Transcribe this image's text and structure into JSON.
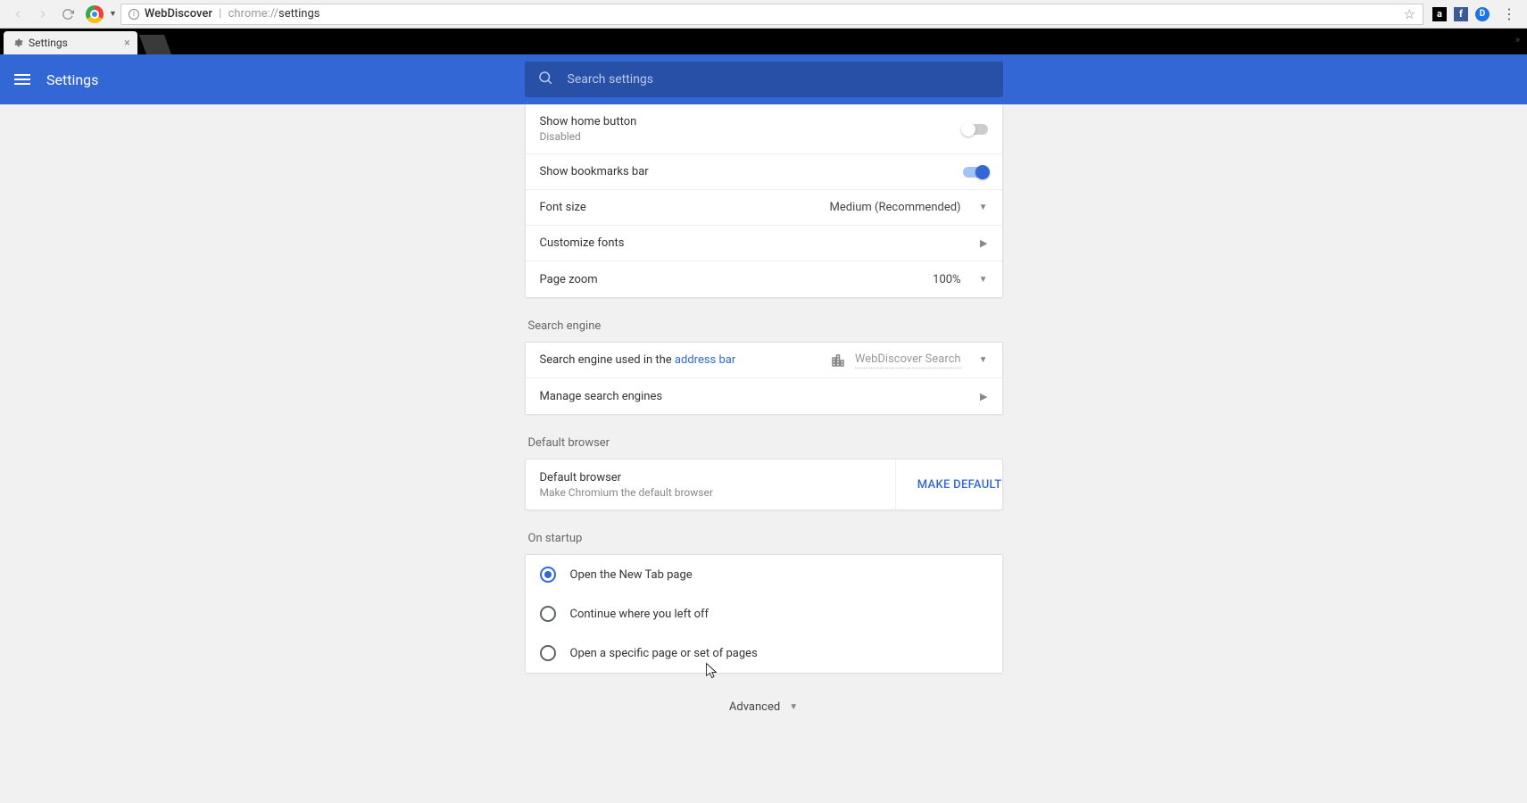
{
  "browser": {
    "address_prefix": "WebDiscover",
    "url_scheme": "chrome://",
    "url_path": "settings",
    "tab_title": "Settings"
  },
  "header": {
    "title": "Settings",
    "search_placeholder": "Search settings"
  },
  "appearance": {
    "show_home_label": "Show home button",
    "show_home_sub": "Disabled",
    "show_bookmarks_label": "Show bookmarks bar",
    "font_size_label": "Font size",
    "font_size_value": "Medium (Recommended)",
    "customize_fonts_label": "Customize fonts",
    "page_zoom_label": "Page zoom",
    "page_zoom_value": "100%"
  },
  "search_engine": {
    "section_title": "Search engine",
    "used_in_prefix": "Search engine used in the ",
    "used_in_link": "address bar",
    "engine_value": "WebDiscover Search",
    "manage_label": "Manage search engines"
  },
  "default_browser": {
    "section_title": "Default browser",
    "row_label": "Default browser",
    "row_sub": "Make Chromium the default browser",
    "button_label": "MAKE DEFAULT"
  },
  "on_startup": {
    "section_title": "On startup",
    "options": [
      "Open the New Tab page",
      "Continue where you left off",
      "Open a specific page or set of pages"
    ],
    "selected_index": 0
  },
  "advanced_label": "Advanced"
}
